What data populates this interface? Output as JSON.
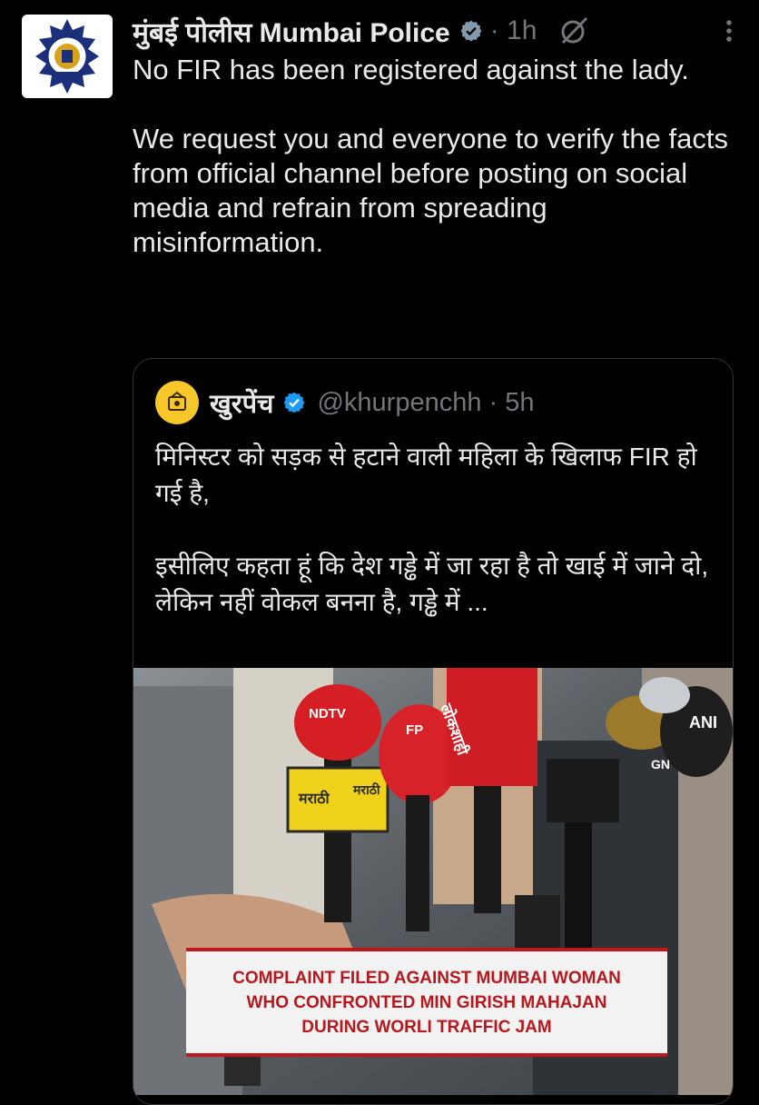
{
  "tweet": {
    "author_name": "मुंबई पोलीस Mumbai Police",
    "time": "· 1h",
    "paragraphs": [
      "No FIR has been registered against the lady.",
      "We request you and everyone to verify the facts from official channel before posting on social media and refrain from spreading misinformation."
    ],
    "icons": {
      "verified": "verified-badge-icon",
      "grok": "grok-icon",
      "more": "more-options-icon"
    }
  },
  "quoted_tweet": {
    "author_name": "खुरपेंच",
    "handle": "@khurpenchh",
    "time": "· 5h",
    "paragraphs": [
      "मिनिस्टर को सड़क से हटाने वाली महिला के खिलाफ FIR हो गई है,",
      "इसीलिए कहता हूं कि देश गड्ढे में जा रहा है तो खाई में जाने दो, लेकिन नहीं वोकल बनना है, गड्ढे में ..."
    ],
    "media": {
      "caption_lines": [
        "COMPLAINT FILED AGAINST MUMBAI WOMAN",
        "WHO CONFRONTED MIN GIRISH MAHAJAN",
        "DURING WORLI TRAFFIC JAM"
      ],
      "mic_labels": [
        "NDTV",
        "मराठी",
        "मराठी",
        "लोकशाही",
        "FP",
        "GN",
        "ANI"
      ]
    }
  },
  "colors": {
    "background": "#000000",
    "text": "#e7e9ea",
    "secondary": "#71767b",
    "verified": "#1d9bf0",
    "caption_red": "#b5181d"
  }
}
